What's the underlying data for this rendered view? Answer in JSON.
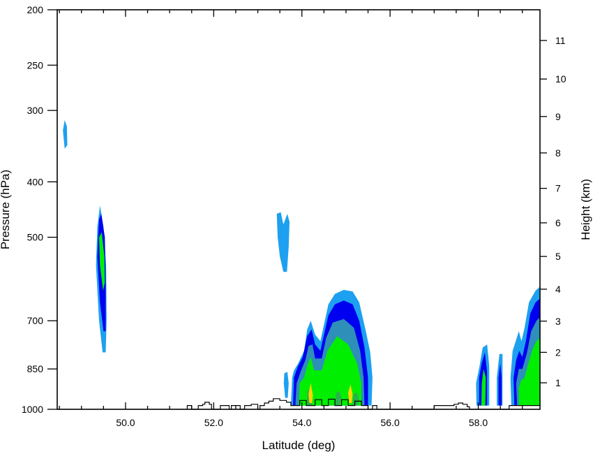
{
  "chart_data": {
    "type": "contour",
    "title": "",
    "xlabel": "Latitude (deg)",
    "ylabel_left": "Pressure (hPa)",
    "ylabel_right": "Height (km)",
    "xlim": [
      48.45,
      59.4
    ],
    "x_ticks": [
      50.0,
      52.0,
      54.0,
      56.0,
      58.0
    ],
    "x_tick_labels": [
      "50.0",
      "52.0",
      "54.0",
      "56.0",
      "58.0"
    ],
    "y_left_scale": "log",
    "y_left_range": [
      1000,
      200
    ],
    "y_left_ticks": [
      200,
      250,
      300,
      400,
      500,
      700,
      850,
      1000
    ],
    "y_left_tick_labels": [
      "200",
      "250",
      "300",
      "400",
      "500",
      "700",
      "850",
      "1000"
    ],
    "y_right_ticks": [
      1,
      2,
      3,
      4,
      5,
      6,
      7,
      8,
      9,
      10,
      11
    ],
    "y_right_tick_labels": [
      "1",
      "2",
      "3",
      "4",
      "5",
      "6",
      "7",
      "8",
      "9",
      "10",
      "11"
    ],
    "fill_levels": [
      {
        "level": 1,
        "color": "#1ea0f0"
      },
      {
        "level": 2,
        "color": "#0000f0"
      },
      {
        "level": 3,
        "color": "#2e8fb8"
      },
      {
        "level": 4,
        "color": "#00ef00"
      },
      {
        "level": 5,
        "color": "#2ab050"
      },
      {
        "level": 6,
        "color": "#ffd700"
      }
    ],
    "regions": [
      {
        "level": 1,
        "points": [
          [
            48.62,
            350
          ],
          [
            48.58,
            325
          ],
          [
            48.62,
            312
          ],
          [
            48.67,
            320
          ],
          [
            48.68,
            345
          ]
        ]
      },
      {
        "level": 1,
        "points": [
          [
            49.48,
            795
          ],
          [
            49.4,
            700
          ],
          [
            49.33,
            560
          ],
          [
            49.36,
            480
          ],
          [
            49.42,
            440
          ],
          [
            49.5,
            480
          ],
          [
            49.56,
            560
          ],
          [
            49.57,
            700
          ],
          [
            49.55,
            795
          ]
        ]
      },
      {
        "level": 2,
        "points": [
          [
            49.5,
            730
          ],
          [
            49.42,
            650
          ],
          [
            49.36,
            540
          ],
          [
            49.4,
            465
          ],
          [
            49.45,
            455
          ],
          [
            49.53,
            500
          ],
          [
            49.55,
            600
          ],
          [
            49.55,
            730
          ]
        ]
      },
      {
        "level": 4,
        "points": [
          [
            49.49,
            620
          ],
          [
            49.42,
            560
          ],
          [
            49.4,
            500
          ],
          [
            49.46,
            490
          ],
          [
            49.52,
            540
          ],
          [
            49.53,
            600
          ]
        ]
      },
      {
        "level": 1,
        "points": [
          [
            53.58,
            575
          ],
          [
            53.5,
            540
          ],
          [
            53.45,
            500
          ],
          [
            53.43,
            455
          ],
          [
            53.52,
            452
          ],
          [
            53.58,
            475
          ],
          [
            53.67,
            455
          ],
          [
            53.72,
            470
          ],
          [
            53.7,
            520
          ],
          [
            53.66,
            575
          ]
        ]
      },
      {
        "level": 1,
        "points": [
          [
            53.75,
            985
          ],
          [
            53.78,
            880
          ],
          [
            53.82,
            855
          ],
          [
            53.92,
            830
          ],
          [
            54.05,
            790
          ],
          [
            54.12,
            725
          ],
          [
            54.2,
            700
          ],
          [
            54.3,
            740
          ],
          [
            54.42,
            760
          ],
          [
            54.52,
            700
          ],
          [
            54.6,
            655
          ],
          [
            54.75,
            628
          ],
          [
            54.95,
            618
          ],
          [
            55.15,
            622
          ],
          [
            55.3,
            650
          ],
          [
            55.45,
            730
          ],
          [
            55.55,
            795
          ],
          [
            55.6,
            880
          ],
          [
            55.58,
            985
          ]
        ]
      },
      {
        "level": 2,
        "points": [
          [
            53.8,
            985
          ],
          [
            53.82,
            880
          ],
          [
            53.9,
            845
          ],
          [
            54.02,
            810
          ],
          [
            54.12,
            745
          ],
          [
            54.22,
            725
          ],
          [
            54.3,
            770
          ],
          [
            54.42,
            790
          ],
          [
            54.52,
            730
          ],
          [
            54.6,
            685
          ],
          [
            54.75,
            655
          ],
          [
            54.95,
            645
          ],
          [
            55.15,
            655
          ],
          [
            55.3,
            700
          ],
          [
            55.42,
            780
          ],
          [
            55.5,
            880
          ],
          [
            55.5,
            985
          ]
        ]
      },
      {
        "level": 3,
        "points": [
          [
            53.85,
            985
          ],
          [
            53.88,
            900
          ],
          [
            53.97,
            860
          ],
          [
            54.08,
            820
          ],
          [
            54.15,
            775
          ],
          [
            54.24,
            770
          ],
          [
            54.3,
            815
          ],
          [
            54.45,
            815
          ],
          [
            54.55,
            750
          ],
          [
            54.7,
            705
          ],
          [
            54.95,
            695
          ],
          [
            55.18,
            720
          ],
          [
            55.32,
            790
          ],
          [
            55.4,
            880
          ],
          [
            55.42,
            985
          ]
        ]
      },
      {
        "level": 4,
        "points": [
          [
            53.93,
            985
          ],
          [
            53.95,
            900
          ],
          [
            54.05,
            880
          ],
          [
            54.12,
            840
          ],
          [
            54.2,
            810
          ],
          [
            54.28,
            855
          ],
          [
            54.45,
            855
          ],
          [
            54.58,
            790
          ],
          [
            54.8,
            745
          ],
          [
            55.05,
            770
          ],
          [
            55.25,
            830
          ],
          [
            55.35,
            900
          ],
          [
            55.35,
            985
          ]
        ]
      },
      {
        "level": 5,
        "points": [
          [
            54.12,
            985
          ],
          [
            54.12,
            930
          ],
          [
            54.2,
            920
          ],
          [
            54.25,
            960
          ],
          [
            54.22,
            985
          ]
        ]
      },
      {
        "level": 5,
        "points": [
          [
            54.75,
            985
          ],
          [
            54.78,
            935
          ],
          [
            54.85,
            930
          ],
          [
            54.9,
            960
          ],
          [
            54.85,
            985
          ]
        ]
      },
      {
        "level": 5,
        "points": [
          [
            55.15,
            985
          ],
          [
            55.17,
            940
          ],
          [
            55.25,
            935
          ],
          [
            55.3,
            965
          ],
          [
            55.25,
            985
          ]
        ]
      },
      {
        "level": 6,
        "points": [
          [
            54.17,
            975
          ],
          [
            54.15,
            940
          ],
          [
            54.2,
            900
          ],
          [
            54.25,
            945
          ],
          [
            54.23,
            975
          ]
        ]
      },
      {
        "level": 6,
        "points": [
          [
            55.07,
            975
          ],
          [
            55.05,
            935
          ],
          [
            55.1,
            905
          ],
          [
            55.15,
            940
          ],
          [
            55.13,
            975
          ]
        ]
      },
      {
        "level": 1,
        "points": [
          [
            53.62,
            955
          ],
          [
            53.59,
            900
          ],
          [
            53.6,
            865
          ],
          [
            53.67,
            860
          ],
          [
            53.7,
            900
          ],
          [
            53.68,
            955
          ]
        ]
      },
      {
        "level": 1,
        "points": [
          [
            57.96,
            985
          ],
          [
            57.95,
            900
          ],
          [
            58.03,
            840
          ],
          [
            58.1,
            780
          ],
          [
            58.2,
            770
          ],
          [
            58.25,
            840
          ],
          [
            58.25,
            985
          ]
        ]
      },
      {
        "level": 2,
        "points": [
          [
            58.02,
            985
          ],
          [
            58.02,
            880
          ],
          [
            58.08,
            830
          ],
          [
            58.15,
            795
          ],
          [
            58.2,
            860
          ],
          [
            58.2,
            985
          ]
        ]
      },
      {
        "level": 4,
        "points": [
          [
            58.07,
            985
          ],
          [
            58.08,
            900
          ],
          [
            58.12,
            850
          ],
          [
            58.17,
            880
          ],
          [
            58.16,
            985
          ]
        ]
      },
      {
        "level": 1,
        "points": [
          [
            58.42,
            985
          ],
          [
            58.42,
            880
          ],
          [
            58.48,
            800
          ],
          [
            58.55,
            800
          ],
          [
            58.55,
            985
          ]
        ]
      },
      {
        "level": 2,
        "points": [
          [
            58.46,
            985
          ],
          [
            58.46,
            880
          ],
          [
            58.5,
            830
          ],
          [
            58.53,
            880
          ],
          [
            58.53,
            985
          ]
        ]
      },
      {
        "level": 1,
        "points": [
          [
            58.75,
            985
          ],
          [
            58.73,
            880
          ],
          [
            58.78,
            790
          ],
          [
            58.85,
            760
          ],
          [
            58.92,
            730
          ],
          [
            58.98,
            760
          ],
          [
            59.05,
            720
          ],
          [
            59.15,
            650
          ],
          [
            59.3,
            620
          ],
          [
            59.4,
            610
          ],
          [
            59.4,
            985
          ]
        ]
      },
      {
        "level": 2,
        "points": [
          [
            58.82,
            985
          ],
          [
            58.8,
            880
          ],
          [
            58.86,
            820
          ],
          [
            58.93,
            790
          ],
          [
            59.0,
            810
          ],
          [
            59.08,
            760
          ],
          [
            59.18,
            680
          ],
          [
            59.3,
            650
          ],
          [
            59.4,
            640
          ],
          [
            59.4,
            985
          ]
        ]
      },
      {
        "level": 3,
        "points": [
          [
            58.88,
            985
          ],
          [
            58.86,
            900
          ],
          [
            58.92,
            850
          ],
          [
            59.0,
            850
          ],
          [
            59.1,
            800
          ],
          [
            59.2,
            730
          ],
          [
            59.32,
            700
          ],
          [
            59.4,
            690
          ],
          [
            59.4,
            985
          ]
        ]
      },
      {
        "level": 4,
        "points": [
          [
            58.92,
            985
          ],
          [
            58.92,
            920
          ],
          [
            58.97,
            890
          ],
          [
            59.05,
            880
          ],
          [
            59.12,
            840
          ],
          [
            59.22,
            790
          ],
          [
            59.32,
            760
          ],
          [
            59.4,
            750
          ],
          [
            59.4,
            985
          ]
        ]
      }
    ],
    "terrain": [
      [
        51.4,
        1000
      ],
      [
        51.4,
        985
      ],
      [
        51.5,
        985
      ],
      [
        51.5,
        1000
      ],
      [
        51.65,
        1000
      ],
      [
        51.65,
        985
      ],
      [
        51.75,
        985
      ],
      [
        51.75,
        980
      ],
      [
        51.8,
        980
      ],
      [
        51.8,
        972
      ],
      [
        51.9,
        972
      ],
      [
        51.9,
        980
      ],
      [
        51.95,
        980
      ],
      [
        51.95,
        1000
      ],
      [
        52.15,
        1000
      ],
      [
        52.15,
        985
      ],
      [
        52.35,
        985
      ],
      [
        52.35,
        1000
      ],
      [
        52.4,
        1000
      ],
      [
        52.4,
        985
      ],
      [
        52.6,
        985
      ],
      [
        52.6,
        1000
      ],
      [
        52.7,
        1000
      ],
      [
        52.7,
        985
      ],
      [
        52.85,
        985
      ],
      [
        52.85,
        980
      ],
      [
        53.0,
        980
      ],
      [
        53.0,
        1000
      ],
      [
        53.05,
        1000
      ],
      [
        53.05,
        985
      ],
      [
        53.15,
        985
      ],
      [
        53.15,
        975
      ],
      [
        53.25,
        975
      ],
      [
        53.25,
        968
      ],
      [
        53.35,
        968
      ],
      [
        53.35,
        958
      ],
      [
        53.5,
        958
      ],
      [
        53.5,
        965
      ],
      [
        53.65,
        965
      ],
      [
        53.65,
        972
      ],
      [
        53.75,
        972
      ],
      [
        53.75,
        985
      ],
      [
        53.95,
        985
      ],
      [
        53.95,
        965
      ],
      [
        54.1,
        965
      ],
      [
        54.1,
        985
      ],
      [
        54.3,
        985
      ],
      [
        54.3,
        962
      ],
      [
        54.45,
        962
      ],
      [
        54.45,
        985
      ],
      [
        54.6,
        985
      ],
      [
        54.6,
        960
      ],
      [
        54.75,
        960
      ],
      [
        54.75,
        985
      ],
      [
        54.9,
        985
      ],
      [
        54.9,
        962
      ],
      [
        55.05,
        962
      ],
      [
        55.05,
        985
      ],
      [
        55.2,
        985
      ],
      [
        55.2,
        968
      ],
      [
        55.35,
        968
      ],
      [
        55.35,
        985
      ],
      [
        55.5,
        985
      ],
      [
        55.5,
        1000
      ],
      [
        55.6,
        1000
      ],
      [
        55.6,
        985
      ],
      [
        55.7,
        985
      ],
      [
        55.7,
        1000
      ],
      [
        57.0,
        1000
      ],
      [
        57.0,
        985
      ],
      [
        57.45,
        985
      ],
      [
        57.45,
        980
      ],
      [
        57.55,
        980
      ],
      [
        57.55,
        975
      ],
      [
        57.65,
        975
      ],
      [
        57.65,
        980
      ],
      [
        57.75,
        980
      ],
      [
        57.75,
        990
      ],
      [
        57.8,
        990
      ],
      [
        57.8,
        1000
      ],
      [
        58.7,
        1000
      ],
      [
        58.7,
        985
      ],
      [
        59.4,
        985
      ]
    ]
  }
}
